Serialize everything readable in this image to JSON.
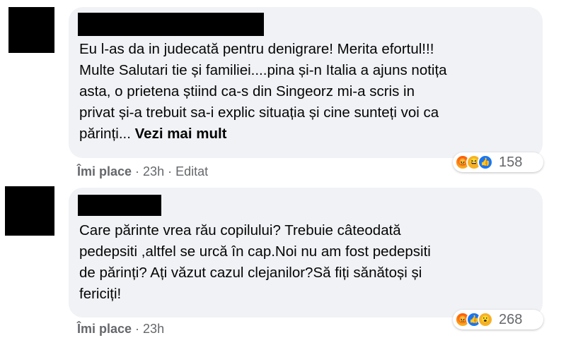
{
  "comments": [
    {
      "text": "Eu l-as da in judecată pentru denigrare! Merita efortul!!!\nMulte Salutari tie și familiei....pina și-n Italia a ajuns notița\nasta, o prietena știind ca-s din Singeorz mi-a scris in\nprivat și-a trebuit sa-i explic situația și cine sunteți voi ca\npărinți... ",
      "see_more": "Vezi mai mult",
      "reaction_count": "158",
      "reaction_icons": [
        "angry-icon",
        "haha-icon",
        "like-icon"
      ],
      "like_label": "Îmi place",
      "time": "23h",
      "edited": "Editat"
    },
    {
      "text": "Care părinte vrea rău copilului? Trebuie câteodată\npedepsiti ,altfel se urcă în cap.Noi nu am fost pedepsiti\nde părinți? Ați văzut cazul clejanilor?Să fiți sănătoși și\nfericiți!",
      "reaction_count": "268",
      "reaction_icons": [
        "angry-icon",
        "like-icon",
        "wow-icon"
      ],
      "like_label": "Îmi place",
      "time": "23h"
    }
  ],
  "separator": "·",
  "colors": {
    "bubble": "#f0f2f5",
    "text": "#050505",
    "meta": "#65676b",
    "like_blue": "#1877f2"
  }
}
